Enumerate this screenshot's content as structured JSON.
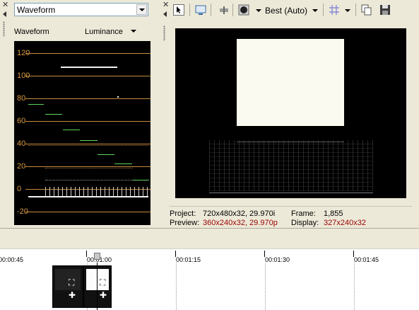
{
  "scope": {
    "mode": "Waveform",
    "title": "Waveform",
    "channel": "Luminance",
    "y_ticks": [
      "120",
      "100",
      "80",
      "60",
      "40",
      "20",
      "0",
      "-20"
    ]
  },
  "preview": {
    "quality": "Best (Auto)",
    "project_label": "Project:",
    "project_value": "720x480x32, 29.970i",
    "preview_label": "Preview:",
    "preview_value": "360x240x32, 29.970p",
    "frame_label": "Frame:",
    "frame_value": "1,855",
    "display_label": "Display:",
    "display_value": "327x240x32"
  },
  "timeline": {
    "times": [
      "00:00:45",
      "00:01:00",
      "00:01:15",
      "00:01:30",
      "00:01:45"
    ]
  },
  "colors": {
    "scope_line": "#c6893f",
    "scope_label": "#d99a40",
    "trace": "#5fd35f",
    "red_text": "#9a0000"
  }
}
